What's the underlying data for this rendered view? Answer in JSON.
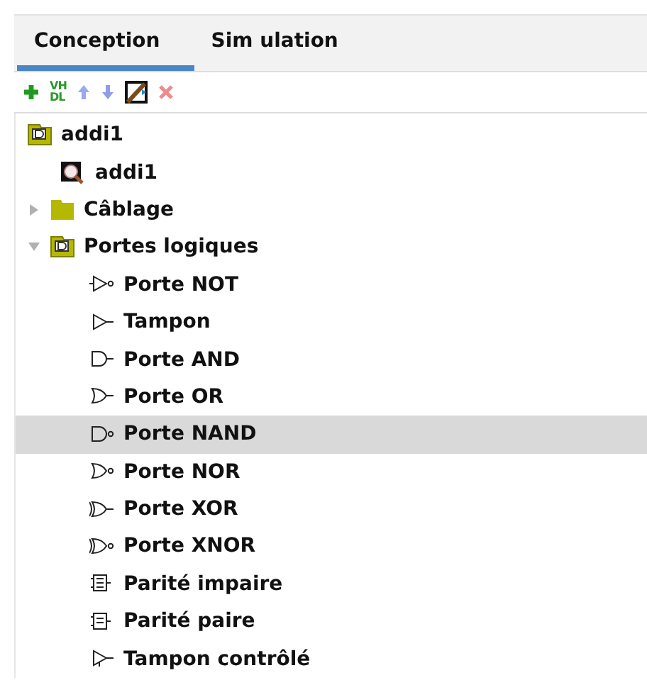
{
  "tabs": [
    {
      "label": "Conception",
      "selected": true
    },
    {
      "label": "Sim ulation",
      "selected": false
    }
  ],
  "toolbar": [
    {
      "kind": "add"
    },
    {
      "kind": "vhdl",
      "lines": [
        "VH",
        "DL"
      ]
    },
    {
      "kind": "up"
    },
    {
      "kind": "down"
    },
    {
      "kind": "edit"
    },
    {
      "kind": "delete"
    }
  ],
  "tree": [
    {
      "label": "addi1",
      "kind": "circuit-folder",
      "selected": false,
      "children": [
        {
          "label": "addi1",
          "kind": "chip",
          "selected": false
        },
        {
          "label": "Câblage",
          "kind": "folder",
          "expanded": false,
          "selected": false
        },
        {
          "label": "Portes logiques",
          "kind": "circuit-folder",
          "expanded": true,
          "selected": false,
          "children": [
            {
              "label": "Porte NOT",
              "kind": "not",
              "selected": false
            },
            {
              "label": "Tampon",
              "kind": "buffer",
              "selected": false
            },
            {
              "label": "Porte AND",
              "kind": "and",
              "selected": false
            },
            {
              "label": "Porte OR",
              "kind": "or",
              "selected": false
            },
            {
              "label": "Porte NAND",
              "kind": "nand",
              "selected": true
            },
            {
              "label": "Porte NOR",
              "kind": "nor",
              "selected": false
            },
            {
              "label": "Porte XOR",
              "kind": "xor",
              "selected": false
            },
            {
              "label": "Porte XNOR",
              "kind": "xnor",
              "selected": false
            },
            {
              "label": "Parité impaire",
              "kind": "odd-parity",
              "selected": false
            },
            {
              "label": "Parité paire",
              "kind": "even-parity",
              "selected": false
            },
            {
              "label": "Tampon contrôlé",
              "kind": "controlled-buffer",
              "selected": false
            }
          ]
        }
      ]
    }
  ]
}
